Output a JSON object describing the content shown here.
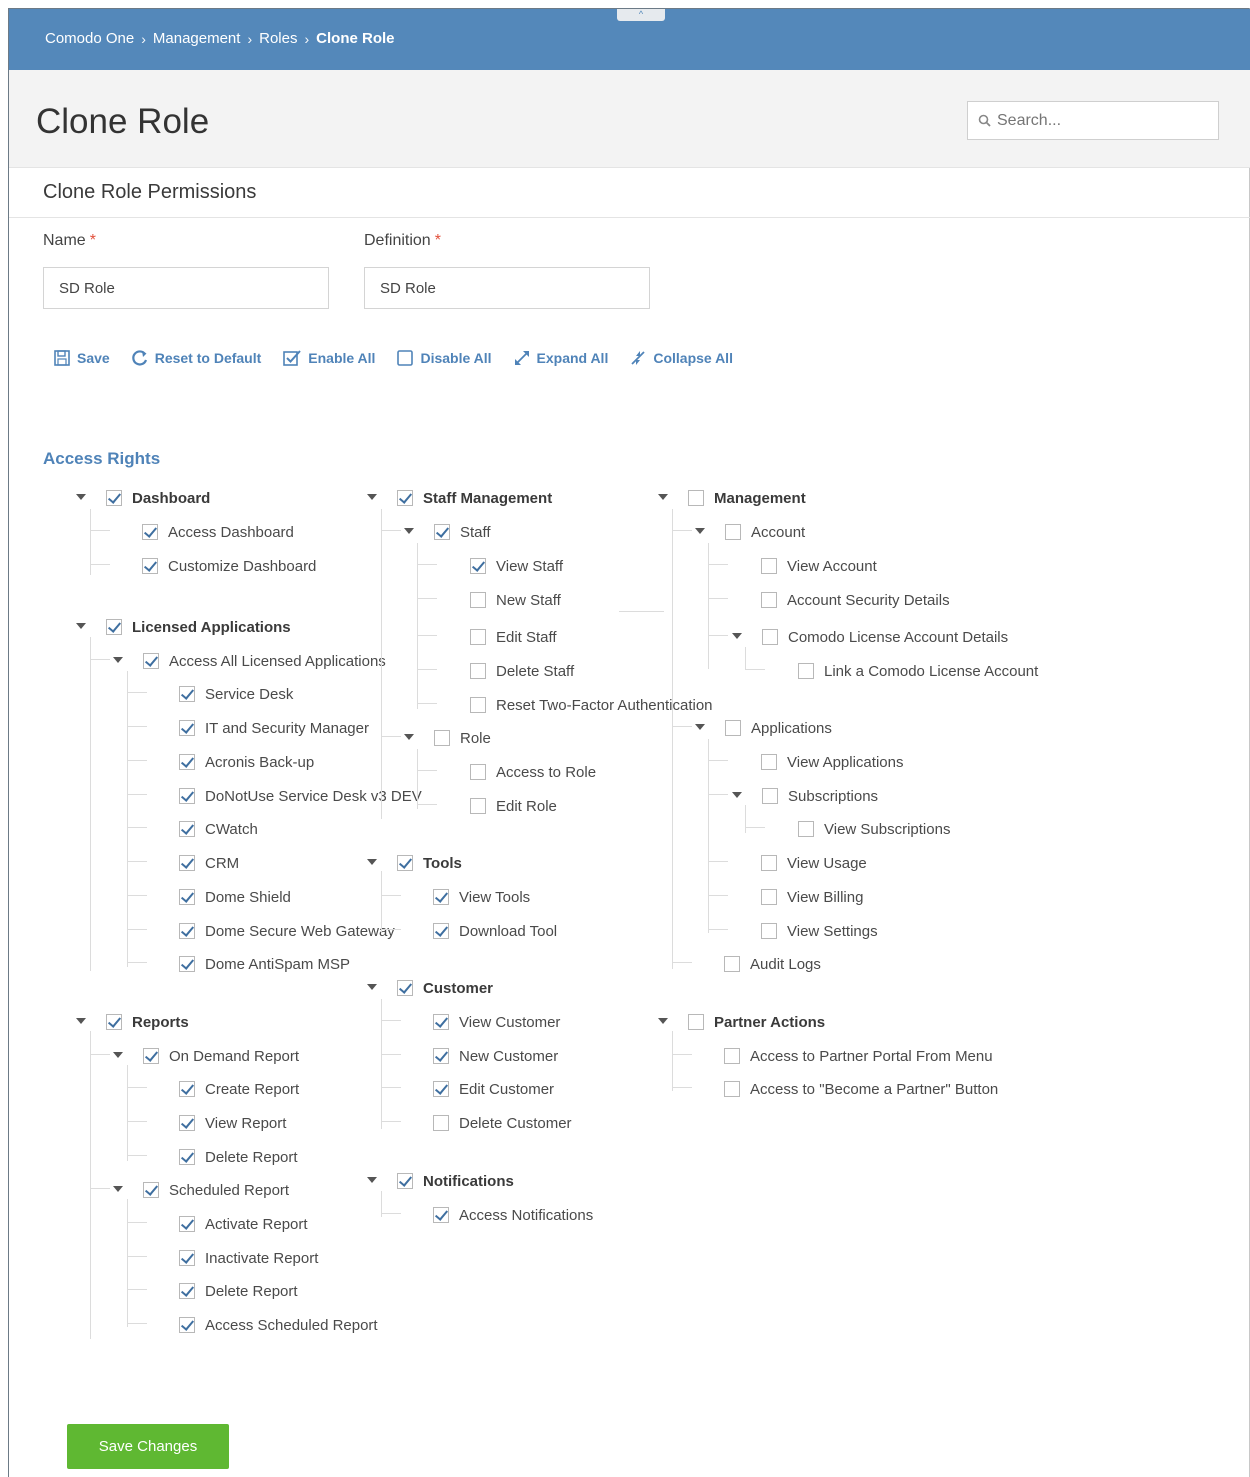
{
  "breadcrumb": [
    "Comodo One",
    "Management",
    "Roles",
    "Clone Role"
  ],
  "page_title": "Clone Role",
  "search": {
    "placeholder": "Search..."
  },
  "section_title": "Clone Role Permissions",
  "form": {
    "name_label": "Name",
    "name_value": "SD Role",
    "definition_label": "Definition",
    "definition_value": "SD Role",
    "required_mark": "*"
  },
  "toolbar": {
    "save": "Save",
    "reset": "Reset to Default",
    "enable_all": "Enable All",
    "disable_all": "Disable All",
    "expand_all": "Expand All",
    "collapse_all": "Collapse All"
  },
  "access_rights_title": "Access Rights",
  "tree": [
    {
      "label": "Dashboard",
      "checked": true,
      "bold": true,
      "arrow": true
    },
    {
      "label": "Access Dashboard",
      "checked": true
    },
    {
      "label": "Customize Dashboard",
      "checked": true
    },
    {
      "label": "Licensed Applications",
      "checked": true,
      "bold": true,
      "arrow": true
    },
    {
      "label": "Access All Licensed Applications",
      "checked": true,
      "arrow": true
    },
    {
      "label": "Service Desk",
      "checked": true
    },
    {
      "label": "IT and Security Manager",
      "checked": true
    },
    {
      "label": "Acronis Back-up",
      "checked": true
    },
    {
      "label": "DoNotUse Service Desk v3 DEV",
      "checked": true
    },
    {
      "label": "CWatch",
      "checked": true
    },
    {
      "label": "CRM",
      "checked": true
    },
    {
      "label": "Dome Shield",
      "checked": true
    },
    {
      "label": "Dome Secure Web Gateway",
      "checked": true
    },
    {
      "label": "Dome AntiSpam MSP",
      "checked": true
    },
    {
      "label": "Reports",
      "checked": true,
      "bold": true,
      "arrow": true
    },
    {
      "label": "On Demand Report",
      "checked": true,
      "arrow": true
    },
    {
      "label": "Create Report",
      "checked": true
    },
    {
      "label": "View Report",
      "checked": true
    },
    {
      "label": "Delete Report",
      "checked": true
    },
    {
      "label": "Scheduled Report",
      "checked": true,
      "arrow": true
    },
    {
      "label": "Activate Report",
      "checked": true
    },
    {
      "label": "Inactivate Report",
      "checked": true
    },
    {
      "label": "Delete Report",
      "checked": true
    },
    {
      "label": "Access Scheduled Report",
      "checked": true
    },
    {
      "label": "Staff Management",
      "checked": true,
      "bold": true,
      "arrow": true
    },
    {
      "label": "Staff",
      "checked": true,
      "arrow": true
    },
    {
      "label": "View Staff",
      "checked": true
    },
    {
      "label": "New Staff",
      "checked": false
    },
    {
      "label": "Edit Staff",
      "checked": false
    },
    {
      "label": "Delete Staff",
      "checked": false
    },
    {
      "label": "Reset Two-Factor Authentication",
      "checked": false
    },
    {
      "label": "Role",
      "checked": false,
      "arrow": true
    },
    {
      "label": "Access to Role",
      "checked": false
    },
    {
      "label": "Edit Role",
      "checked": false
    },
    {
      "label": "Tools",
      "checked": true,
      "bold": true,
      "arrow": true
    },
    {
      "label": "View Tools",
      "checked": true
    },
    {
      "label": "Download Tool",
      "checked": true
    },
    {
      "label": "Customer",
      "checked": true,
      "bold": true,
      "arrow": true
    },
    {
      "label": "View Customer",
      "checked": true
    },
    {
      "label": "New Customer",
      "checked": true
    },
    {
      "label": "Edit Customer",
      "checked": true
    },
    {
      "label": "Delete Customer",
      "checked": false
    },
    {
      "label": "Notifications",
      "checked": true,
      "bold": true,
      "arrow": true
    },
    {
      "label": "Access Notifications",
      "checked": true
    },
    {
      "label": "Management",
      "checked": false,
      "bold": true,
      "arrow": true
    },
    {
      "label": "Account",
      "checked": false,
      "arrow": true
    },
    {
      "label": "View Account",
      "checked": false
    },
    {
      "label": "Account Security Details",
      "checked": false
    },
    {
      "label": "Comodo License Account Details",
      "checked": false,
      "arrow": true
    },
    {
      "label": "Link a Comodo License Account",
      "checked": false
    },
    {
      "label": "Applications",
      "checked": false,
      "arrow": true
    },
    {
      "label": "View Applications",
      "checked": false
    },
    {
      "label": "Subscriptions",
      "checked": false,
      "arrow": true
    },
    {
      "label": "View Subscriptions",
      "checked": false
    },
    {
      "label": "View Usage",
      "checked": false
    },
    {
      "label": "View Billing",
      "checked": false
    },
    {
      "label": "View Settings",
      "checked": false
    },
    {
      "label": "Audit Logs",
      "checked": false
    },
    {
      "label": "Partner Actions",
      "checked": false,
      "bold": true,
      "arrow": true
    },
    {
      "label": "Access to Partner Portal From Menu",
      "checked": false
    },
    {
      "label": "Access to \"Become a Partner\" Button",
      "checked": false
    }
  ],
  "save_changes": "Save Changes",
  "colors": {
    "header": "#5488ba",
    "accent": "#4f83b8",
    "save": "#5fb832",
    "required": "#e2503b"
  }
}
